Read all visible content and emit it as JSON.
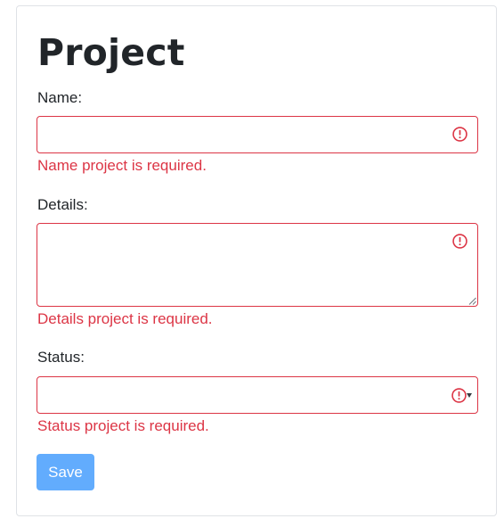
{
  "form": {
    "title": "Project",
    "name": {
      "label": "Name:",
      "value": "",
      "error": "Name project is required."
    },
    "details": {
      "label": "Details:",
      "value": "",
      "error": "Details project is required."
    },
    "status": {
      "label": "Status:",
      "value": "",
      "error": "Status project is required."
    },
    "save_label": "Save"
  },
  "colors": {
    "error": "#dc3545",
    "button": "#62acfd",
    "border": "#dfe2e6"
  },
  "icons": {
    "field_error": "exclamation-circle-icon",
    "select_arrow": "caret-down-icon",
    "resize": "resize-grip-icon"
  }
}
